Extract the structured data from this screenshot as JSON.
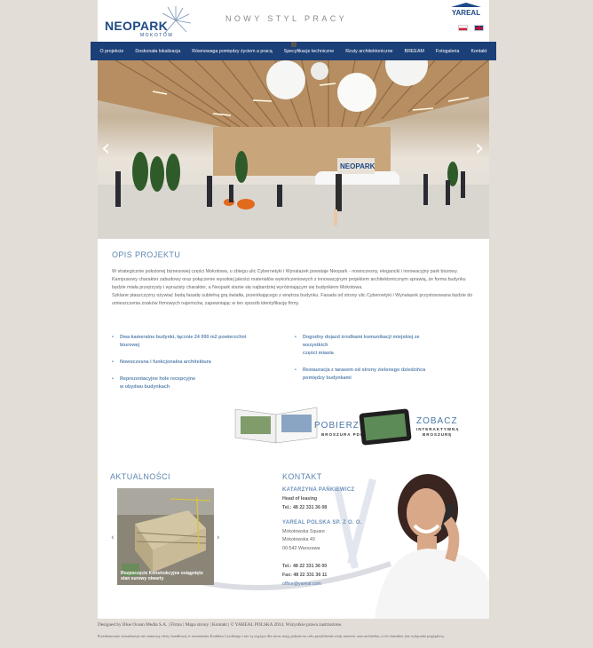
{
  "header": {
    "logo_text": "NEOPARK",
    "logo_sub": "MOKOTÓW",
    "tagline": "NOWY STYL PRACY",
    "brand": "YAREAL"
  },
  "nav": {
    "items": [
      {
        "label": "O projekcie"
      },
      {
        "label": "Doskonała lokalizacja"
      },
      {
        "label": "Równowaga pomiędzy życiem a pracą"
      },
      {
        "label": "Specyfikacje techniczne"
      },
      {
        "label": "Rzuty architektoniczne"
      },
      {
        "label": "BREEAM"
      },
      {
        "label": "Fotogaleria"
      },
      {
        "label": "Kontakt"
      }
    ]
  },
  "hero": {
    "prev": "‹",
    "next": "›",
    "lobby_sign": "NEOPARK"
  },
  "opis": {
    "title": "OPIS PROJEKTU",
    "paragraph1": "W strategicznie położonej biznesowej części Mokotowa, u zbiegu ulic Cybernetyki i Wynalazek powstaje Neopark - nowoczesny, elegancki i innowacyjny park biurowy. Kampusowy charakter zabudowy oraz połączenie wysokiej jakości materiałów wykończeniowych z innowacyjnym projektem architektonicznym sprawią, że forma budynku będzie miała przejrzysty i wyrazisty charakter, a Neopark stanie się najbardziej wyróżniającym się budynkiem Mokotowa.",
    "paragraph2": "Szklane płaszczyzny ożywiać będą fasadę subtelną grą światła, przenikającego z wnętrza budynku. Fasada od strony ulic Cybernetyki i Wynalazek przystosowana będzie do umieszczenia znaków firmowych najemców, zapewniając w ten sposób identyfikację firmy.",
    "features_left": [
      {
        "l1": "Dwa kameralne budynki, łącznie 24 000 m2 powierzchni",
        "l2": "biurowej"
      },
      {
        "l1": "Nowoczesna i funkcjonalna architektura",
        "l2": ""
      },
      {
        "l1": "Reprezentacyjne hole recepcyjne",
        "l2": "w obydwu budynkach"
      }
    ],
    "features_right": [
      {
        "l1": "Dogodny dojazd środkami komunikacji miejskiej ze",
        "l2": "wszystkich",
        "l3": "części miasta"
      },
      {
        "l1": "Restauracja z tarasem od strony zielonego dziedzińca",
        "l2": "pomiędzy budynkami",
        "l3": ""
      }
    ]
  },
  "brochure": {
    "download": "POBIERZ",
    "download_sub": "BROSZURA PDF",
    "view": "ZOBACZ",
    "view_sub1": "INTERAKTYWNĄ",
    "view_sub2": "BROSZURĘ"
  },
  "news": {
    "title": "AKTUALNOŚCI",
    "caption": "Rozpoczęcie Konstrukcyjne osiągnięto stan surowy otwarty",
    "prev": "‹",
    "next": "›"
  },
  "contact": {
    "title": "KONTAKT",
    "person_name": "KATARZYNA PAŃKIEWICZ",
    "person_role": "Head of leasing",
    "person_tel": "Tel.: 48 22 331 36 08",
    "company": "YAREAL POLSKA SP. Z O. O.",
    "addr1": "Mokotowska Square",
    "addr2": "Mokotowska 49",
    "addr3": "00-542 Warszawa",
    "tel": "Tel.: 48 22 331 36 00",
    "fax": "Fax: 48 22 331 36 11",
    "email": "office@yareal.com"
  },
  "footer": {
    "designed": "Designed by Blue Ocean Media S.A.",
    "sep": "|",
    "firma": "Firma",
    "mapa": "Mapa strony",
    "kontakt": "Kontakt",
    "copyright": "© YAREAL POLSKA 2014. Wszystkie prawa zastrzeżone.",
    "note": "Przedstawione wizualizacje nie stanowią oferty handlowej w rozumieniu Kodeksu Cywilnego i nie są wiążące dla stron; mają jedynie na celu przybliżenie wizji autorów oraz architekta, a ich charakter jest wyłącznie poglądowy."
  },
  "colors": {
    "nav_bg": "#1b3f77",
    "accent": "#5e86b1",
    "page_bg": "#e3ddd8"
  }
}
